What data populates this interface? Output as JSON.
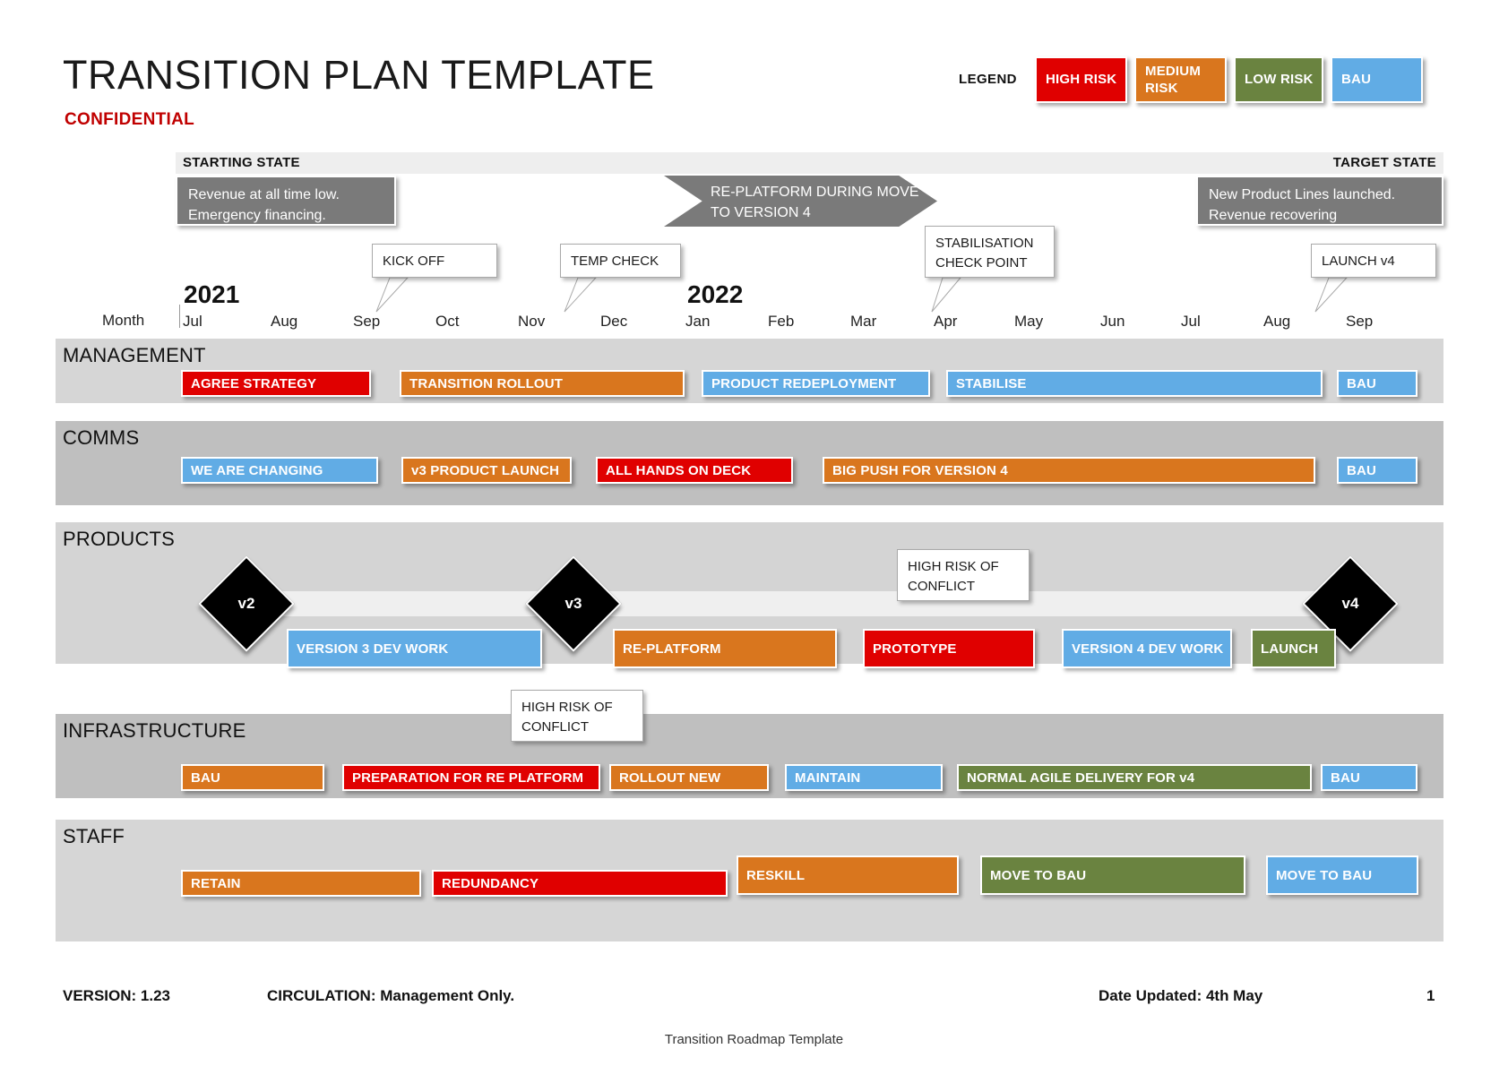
{
  "header": {
    "title": "TRANSITION PLAN TEMPLATE",
    "confidential": "CONFIDENTIAL"
  },
  "legend": {
    "label": "LEGEND",
    "items": [
      {
        "label": "HIGH RISK",
        "color": "#e00000"
      },
      {
        "label": "MEDIUM RISK",
        "color": "#d9761e"
      },
      {
        "label": "LOW RISK",
        "color": "#6a8340"
      },
      {
        "label": "BAU",
        "color": "#61ace5"
      }
    ]
  },
  "states": {
    "starting_label": "STARTING STATE",
    "target_label": "TARGET STATE",
    "starting_text": "Revenue at all time low. Emergency financing.",
    "target_text": "New Product Lines launched. Revenue recovering",
    "chevron_text": "RE-PLATFORM DURING MOVE TO VERSION 4"
  },
  "callouts": {
    "kick_off": "KICK OFF",
    "temp_check": "TEMP CHECK",
    "stabilisation": "STABILISATION CHECK POINT",
    "launch_v4": "LAUNCH v4",
    "high_risk_products": "HIGH RISK OF CONFLICT",
    "high_risk_infra": "HIGH RISK OF CONFLICT"
  },
  "axis": {
    "month_label": "Month",
    "years": [
      {
        "label": "2021"
      },
      {
        "label": "2022"
      }
    ],
    "months": [
      "Jul",
      "Aug",
      "Sep",
      "Oct",
      "Nov",
      "Dec",
      "Jan",
      "Feb",
      "Mar",
      "Apr",
      "May",
      "Jun",
      "Jul",
      "Aug",
      "Sep"
    ]
  },
  "lanes": [
    {
      "name": "MANAGEMENT",
      "bars": [
        {
          "label": "AGREE STRATEGY",
          "risk": "high"
        },
        {
          "label": "TRANSITION ROLLOUT",
          "risk": "medium"
        },
        {
          "label": "PRODUCT REDEPLOYMENT",
          "risk": "bau"
        },
        {
          "label": "STABILISE",
          "risk": "bau"
        },
        {
          "label": "BAU",
          "risk": "bau"
        }
      ]
    },
    {
      "name": "COMMS",
      "bars": [
        {
          "label": "WE ARE CHANGING",
          "risk": "bau"
        },
        {
          "label": "v3 PRODUCT LAUNCH",
          "risk": "medium"
        },
        {
          "label": "ALL HANDS ON DECK",
          "risk": "high"
        },
        {
          "label": "BIG PUSH FOR VERSION 4",
          "risk": "medium"
        },
        {
          "label": "BAU",
          "risk": "bau"
        }
      ]
    },
    {
      "name": "PRODUCTS",
      "milestones": [
        {
          "label": "v2"
        },
        {
          "label": "v3"
        },
        {
          "label": "v4"
        }
      ],
      "bars": [
        {
          "label": "VERSION 3 DEV WORK",
          "risk": "bau"
        },
        {
          "label": "RE-PLATFORM",
          "risk": "medium"
        },
        {
          "label": "PROTOTYPE",
          "risk": "high"
        },
        {
          "label": "VERSION 4 DEV WORK",
          "risk": "bau"
        },
        {
          "label": "LAUNCH",
          "risk": "low"
        }
      ]
    },
    {
      "name": "INFRASTRUCTURE",
      "bars": [
        {
          "label": "BAU",
          "risk": "medium"
        },
        {
          "label": "PREPARATION FOR RE PLATFORM",
          "risk": "high"
        },
        {
          "label": "ROLLOUT NEW",
          "risk": "medium"
        },
        {
          "label": "MAINTAIN",
          "risk": "bau"
        },
        {
          "label": "NORMAL AGILE DELIVERY FOR v4",
          "risk": "low"
        },
        {
          "label": "BAU",
          "risk": "bau"
        }
      ]
    },
    {
      "name": "STAFF",
      "bars": [
        {
          "label": "RETAIN",
          "risk": "medium"
        },
        {
          "label": "REDUNDANCY",
          "risk": "high"
        },
        {
          "label": "RESKILL",
          "risk": "medium"
        },
        {
          "label": "MOVE TO BAU",
          "risk": "low"
        },
        {
          "label": "MOVE TO BAU",
          "risk": "bau"
        }
      ]
    }
  ],
  "footer": {
    "version": "VERSION: 1.23",
    "circulation": "CIRCULATION: Management Only.",
    "date_updated": "Date Updated: 4th May",
    "page_number": "1",
    "subtitle": "Transition Roadmap Template"
  }
}
